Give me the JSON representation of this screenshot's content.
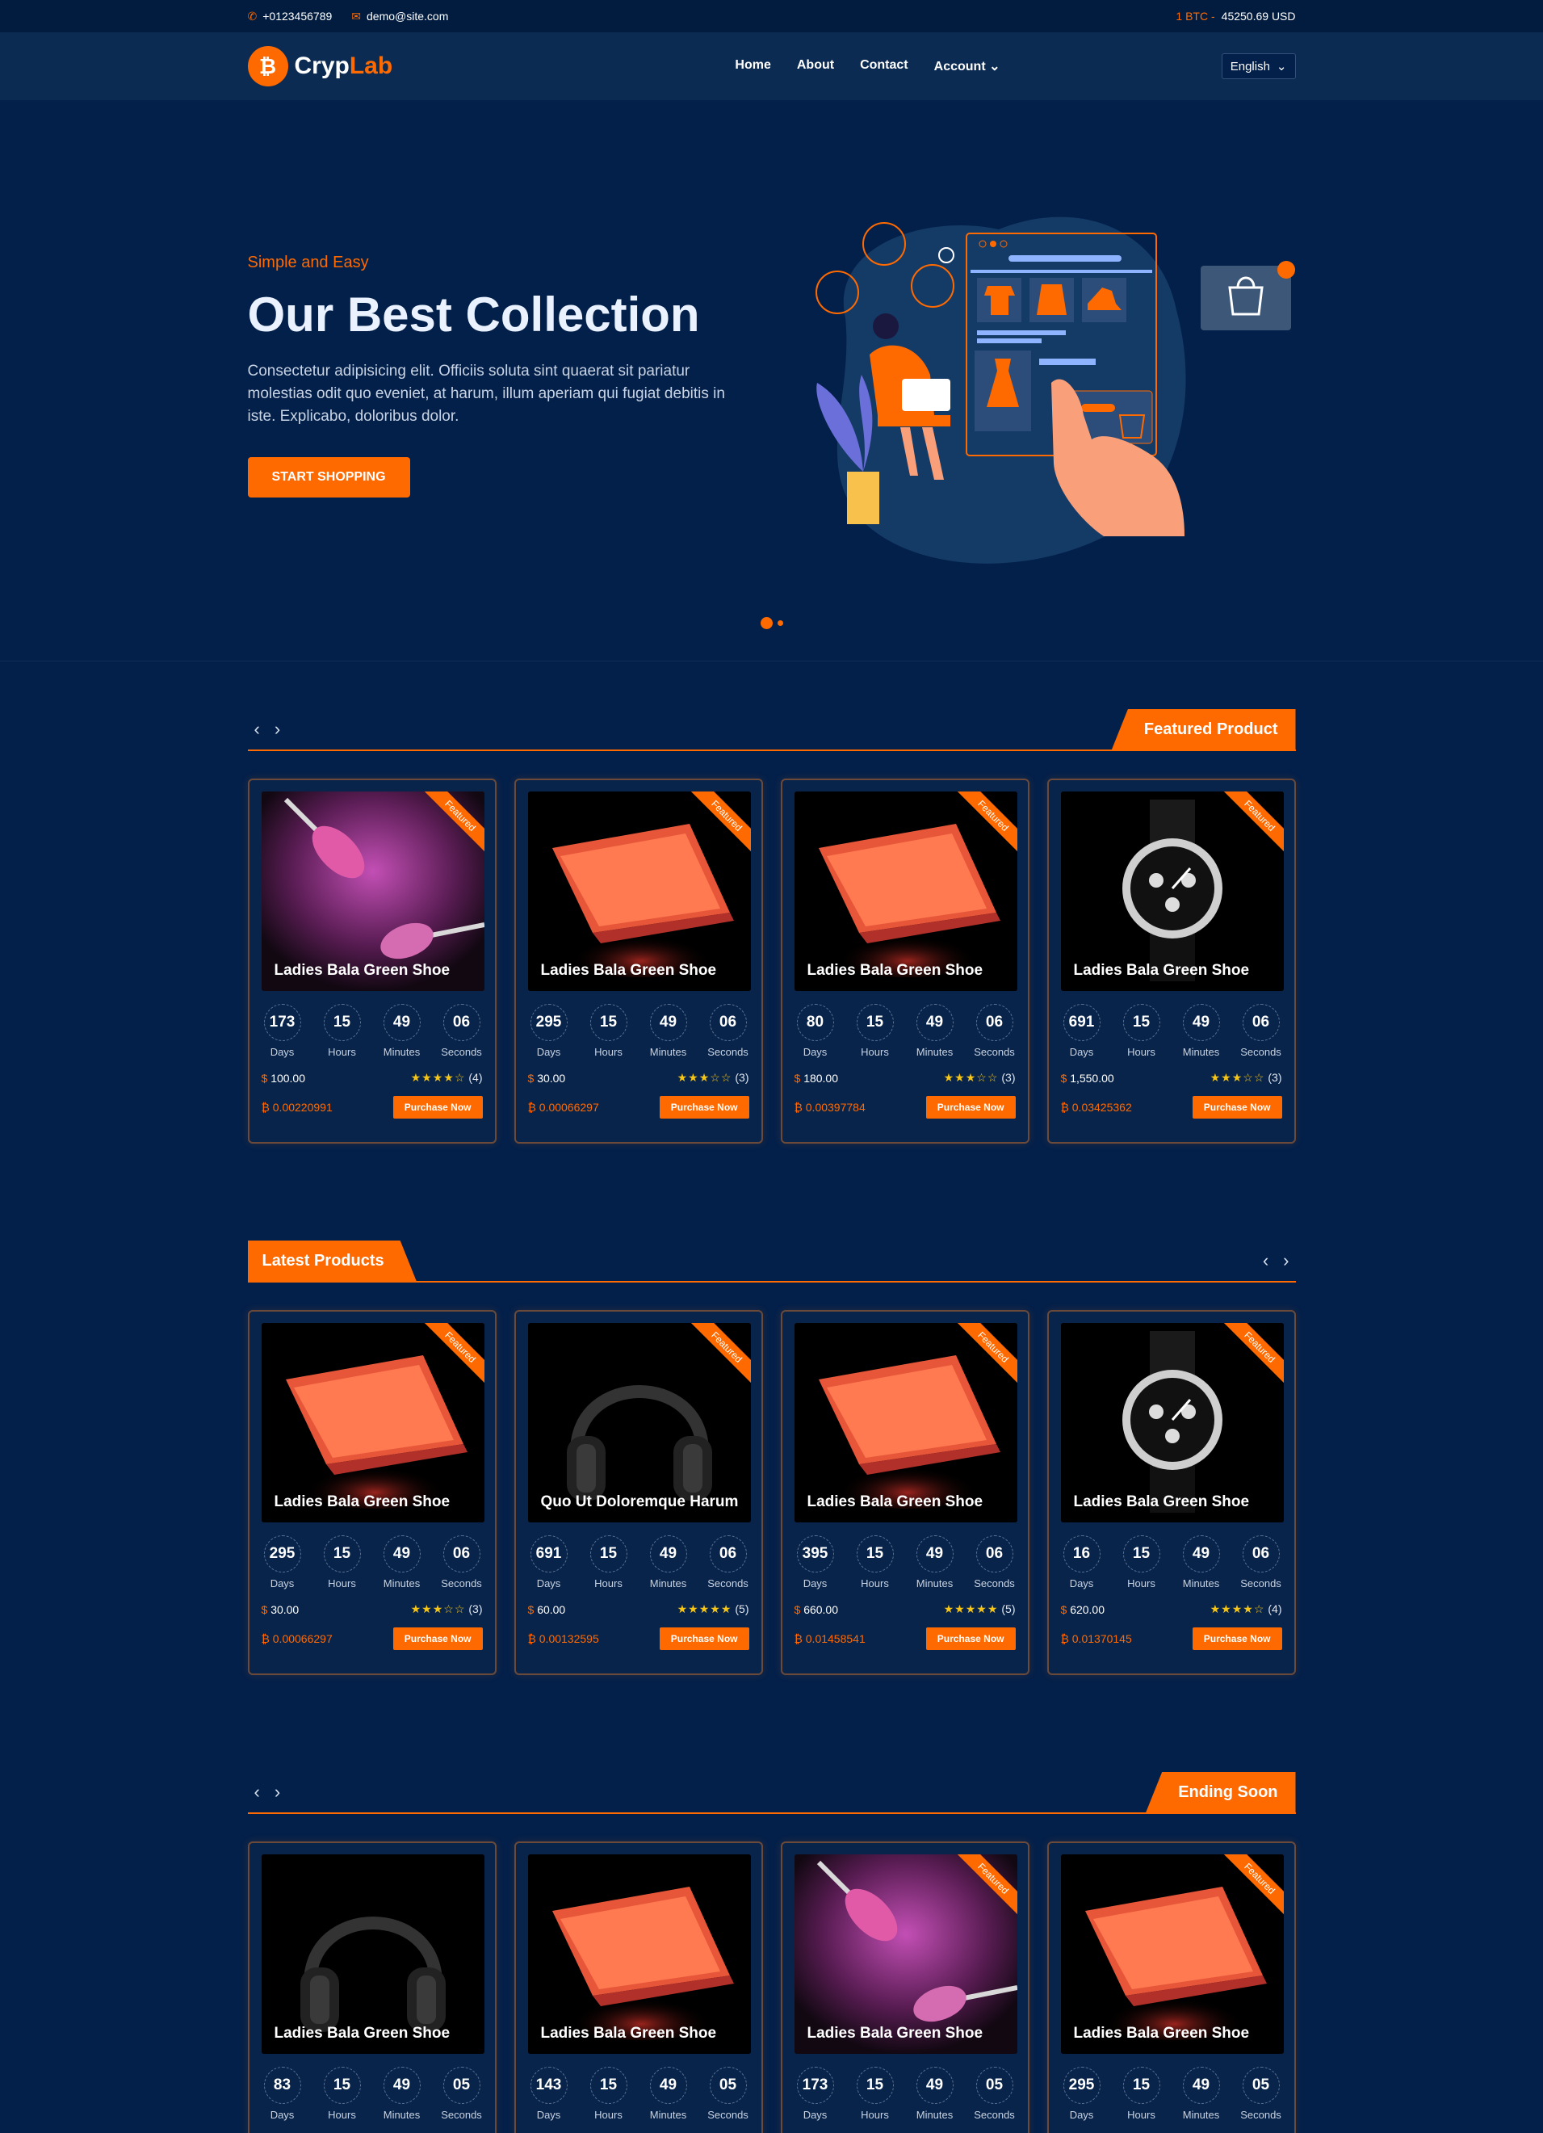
{
  "topbar": {
    "phone": "+0123456789",
    "email": "demo@site.com",
    "btc_label": "1 BTC -",
    "btc_value": "45250.69 USD"
  },
  "brand": {
    "part1": "Cryp",
    "part2": "Lab",
    "badge": "₿"
  },
  "nav": {
    "items": [
      "Home",
      "About",
      "Contact",
      "Account"
    ],
    "language": "English"
  },
  "hero": {
    "subtitle": "Simple and Easy",
    "title": "Our Best Collection",
    "description": "Consectetur adipisicing elit. Officiis soluta sint quaerat sit pariatur molestias odit quo eveniet, at harum, illum aperiam qui fugiat debitis in iste. Explicabo, doloribus dolor.",
    "cta": "START SHOPPING"
  },
  "timer_labels": [
    "Days",
    "Hours",
    "Minutes",
    "Seconds"
  ],
  "buy_label": "Purchase Now",
  "ribbon_label": "Featured",
  "sections": [
    {
      "title": "Featured Product",
      "products": [
        {
          "image": "makeup-brush",
          "name": "Ladies Bala Green Shoe",
          "days": "173",
          "hours": "15",
          "minutes": "49",
          "seconds": "06",
          "price": "100.00",
          "stars": 4,
          "rating": "(4)",
          "crypto": "0.00220991",
          "featured": true
        },
        {
          "image": "laptop",
          "name": "Ladies Bala Green Shoe",
          "days": "295",
          "hours": "15",
          "minutes": "49",
          "seconds": "06",
          "price": "30.00",
          "stars": 3,
          "rating": "(3)",
          "crypto": "0.00066297",
          "featured": true
        },
        {
          "image": "laptop",
          "name": "Ladies Bala Green Shoe",
          "days": "80",
          "hours": "15",
          "minutes": "49",
          "seconds": "06",
          "price": "180.00",
          "stars": 3,
          "rating": "(3)",
          "crypto": "0.00397784",
          "featured": true
        },
        {
          "image": "watch",
          "name": "Ladies Bala Green Shoe",
          "days": "691",
          "hours": "15",
          "minutes": "49",
          "seconds": "06",
          "price": "1,550.00",
          "stars": 3,
          "rating": "(3)",
          "crypto": "0.03425362",
          "featured": true
        }
      ]
    },
    {
      "title": "Latest Products",
      "products": [
        {
          "image": "laptop",
          "name": "Ladies Bala Green Shoe",
          "days": "295",
          "hours": "15",
          "minutes": "49",
          "seconds": "06",
          "price": "30.00",
          "stars": 3,
          "rating": "(3)",
          "crypto": "0.00066297",
          "featured": true
        },
        {
          "image": "headphones",
          "name": "Quo Ut Doloremque Harum",
          "days": "691",
          "hours": "15",
          "minutes": "49",
          "seconds": "06",
          "price": "60.00",
          "stars": 5,
          "rating": "(5)",
          "crypto": "0.00132595",
          "featured": true
        },
        {
          "image": "laptop",
          "name": "Ladies Bala Green Shoe",
          "days": "395",
          "hours": "15",
          "minutes": "49",
          "seconds": "06",
          "price": "660.00",
          "stars": 5,
          "rating": "(5)",
          "crypto": "0.01458541",
          "featured": true
        },
        {
          "image": "watch",
          "name": "Ladies Bala Green Shoe",
          "days": "16",
          "hours": "15",
          "minutes": "49",
          "seconds": "06",
          "price": "620.00",
          "stars": 4,
          "rating": "(4)",
          "crypto": "0.01370145",
          "featured": true
        }
      ]
    },
    {
      "title": "Ending Soon",
      "products": [
        {
          "image": "headphones",
          "name": "Ladies Bala Green Shoe",
          "days": "83",
          "hours": "15",
          "minutes": "49",
          "seconds": "05",
          "featured": false
        },
        {
          "image": "laptop",
          "name": "Ladies Bala Green Shoe",
          "days": "143",
          "hours": "15",
          "minutes": "49",
          "seconds": "05",
          "featured": false
        },
        {
          "image": "makeup-brush",
          "name": "Ladies Bala Green Shoe",
          "days": "173",
          "hours": "15",
          "minutes": "49",
          "seconds": "05",
          "featured": true
        },
        {
          "image": "laptop",
          "name": "Ladies Bala Green Shoe",
          "days": "295",
          "hours": "15",
          "minutes": "49",
          "seconds": "05",
          "featured": true
        }
      ]
    }
  ]
}
